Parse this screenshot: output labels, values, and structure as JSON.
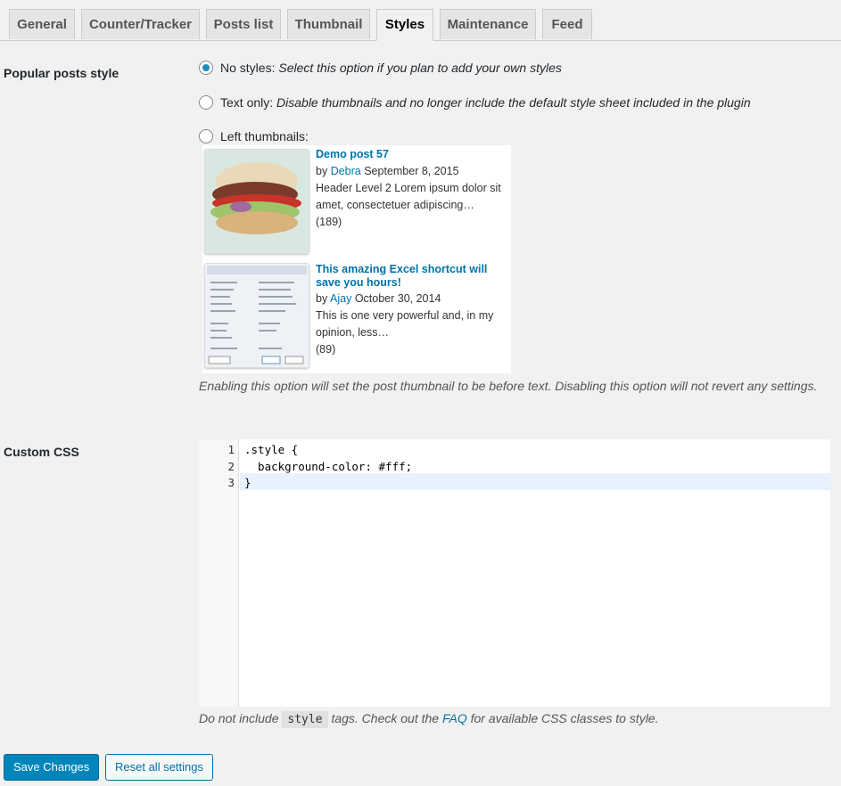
{
  "tabs": [
    {
      "label": "General",
      "active": false
    },
    {
      "label": "Counter/Tracker",
      "active": false
    },
    {
      "label": "Posts list",
      "active": false
    },
    {
      "label": "Thumbnail",
      "active": false
    },
    {
      "label": "Styles",
      "active": true
    },
    {
      "label": "Maintenance",
      "active": false
    },
    {
      "label": "Feed",
      "active": false
    }
  ],
  "popular_style": {
    "label": "Popular posts style",
    "options": [
      {
        "name": "No styles:",
        "desc": "Select this option if you plan to add your own styles",
        "checked": true
      },
      {
        "name": "Text only:",
        "desc": "Disable thumbnails and no longer include the default style sheet included in the plugin",
        "checked": false
      },
      {
        "name": "Left thumbnails:",
        "desc": "",
        "checked": false
      }
    ],
    "preview": [
      {
        "title": "Demo post 57",
        "by": "by",
        "author": "Debra",
        "date": "September 8, 2015",
        "excerpt1": "Header Level 2 Lorem ipsum dolor sit",
        "excerpt2": "amet, consectetuer adipiscing…",
        "views": "(189)",
        "thumb_icon": "burger-image"
      },
      {
        "title": "This amazing Excel shortcut will save you hours!",
        "by": "by",
        "author": "Ajay",
        "date": "October 30, 2014",
        "excerpt1": "This is one very powerful and, in my",
        "excerpt2": "opinion, less…",
        "views": "(89)",
        "thumb_icon": "excel-dialog-image"
      }
    ],
    "note": "Enabling this option will set the post thumbnail to be before text. Disabling this option will not revert any settings."
  },
  "custom_css": {
    "label": "Custom CSS",
    "line_numbers": [
      "1",
      "2",
      "3"
    ],
    "lines": [
      ".style {",
      "  background-color: #fff;",
      "}"
    ],
    "help_prefix": "Do not include",
    "help_code": "style",
    "help_mid": "tags. Check out the",
    "help_link": "FAQ",
    "help_suffix": "for available CSS classes to style."
  },
  "buttons": {
    "save": "Save Changes",
    "reset": "Reset all settings"
  },
  "colors": {
    "accent": "#0073aa",
    "primary_button": "#0085ba"
  }
}
